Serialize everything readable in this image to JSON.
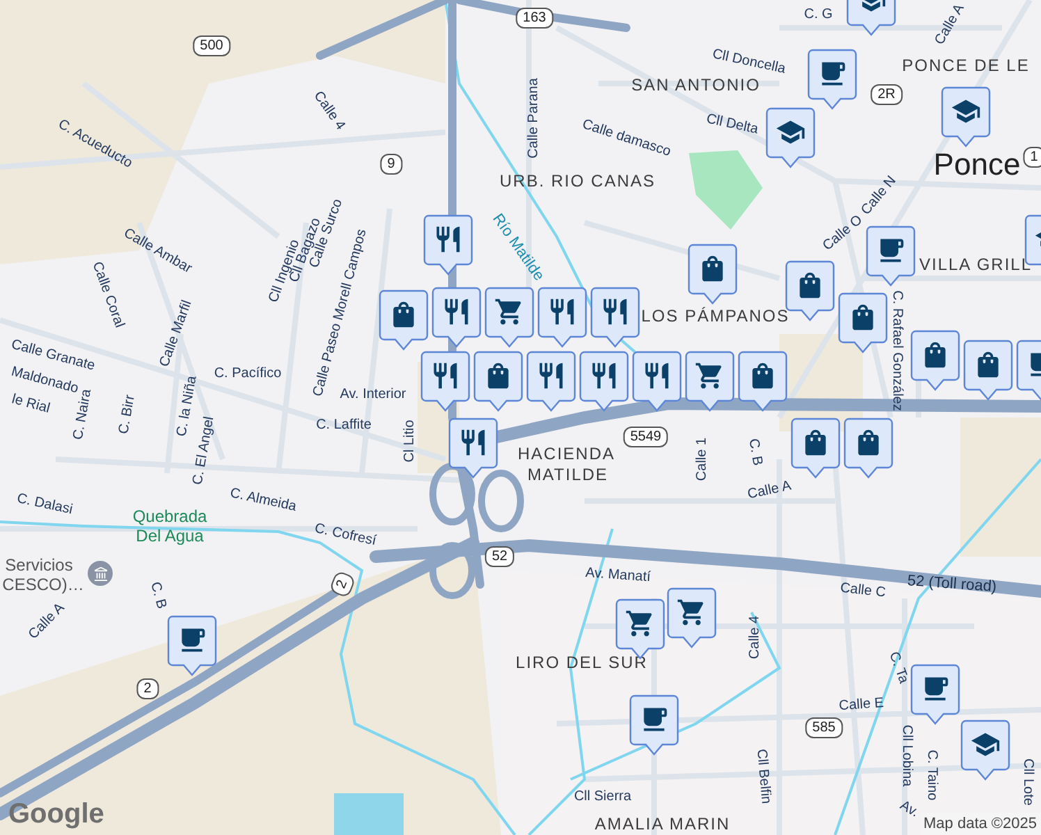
{
  "labels": [
    {
      "text": "500",
      "kind": "route"
    },
    {
      "text": "163",
      "kind": "route"
    },
    {
      "text": "2R",
      "kind": "route"
    },
    {
      "text": "9",
      "kind": "route"
    },
    {
      "text": "PONCE DE LE",
      "kind": "area"
    },
    {
      "text": "SAN ANTONIO",
      "kind": "area"
    },
    {
      "text": "URB. RIO CANAS",
      "kind": "area"
    },
    {
      "text": "Ponce",
      "kind": "city"
    },
    {
      "text": "1",
      "kind": "route"
    },
    {
      "text": "Calle 4",
      "kind": "street"
    },
    {
      "text": "C. Acueducto",
      "kind": "street"
    },
    {
      "text": "Calle Parana",
      "kind": "street"
    },
    {
      "text": "Calle damasco",
      "kind": "street"
    },
    {
      "text": "Cll Doncella",
      "kind": "street"
    },
    {
      "text": "Cll Delta",
      "kind": "street"
    },
    {
      "text": "Calle A",
      "kind": "street"
    },
    {
      "text": "C. G",
      "kind": "street"
    },
    {
      "text": "Calle Ambar",
      "kind": "street"
    },
    {
      "text": "Calle Coral",
      "kind": "street"
    },
    {
      "text": "Calle Marfil",
      "kind": "street"
    },
    {
      "text": "Cll Ingenio",
      "kind": "street"
    },
    {
      "text": "Cll Bagazo",
      "kind": "street"
    },
    {
      "text": "Calle Surco",
      "kind": "street"
    },
    {
      "text": "Calle Paseo Morell Campos",
      "kind": "street"
    },
    {
      "text": "Río Matilde",
      "kind": "water"
    },
    {
      "text": "Calle N",
      "kind": "street"
    },
    {
      "text": "Calle O",
      "kind": "street"
    },
    {
      "text": "C. Rafael González",
      "kind": "street"
    },
    {
      "text": "VILLA GRILL",
      "kind": "area"
    },
    {
      "text": "LOS PÁMPANOS",
      "kind": "area"
    },
    {
      "text": "Calle Granate",
      "kind": "street"
    },
    {
      "text": "Maldonado",
      "kind": "street"
    },
    {
      "text": "le Rial",
      "kind": "street"
    },
    {
      "text": "C. Pacífico",
      "kind": "street"
    },
    {
      "text": "Av. Interior",
      "kind": "street"
    },
    {
      "text": "C. Naira",
      "kind": "street"
    },
    {
      "text": "C. Birr",
      "kind": "street"
    },
    {
      "text": "C. la Niña",
      "kind": "street"
    },
    {
      "text": "C. El Angel",
      "kind": "street"
    },
    {
      "text": "C. Laffite",
      "kind": "street"
    },
    {
      "text": "Cl Litio",
      "kind": "street"
    },
    {
      "text": "HACIENDA",
      "kind": "area"
    },
    {
      "text": "MATILDE",
      "kind": "area"
    },
    {
      "text": "5549",
      "kind": "route"
    },
    {
      "text": "Calle 1",
      "kind": "street"
    },
    {
      "text": "C. B",
      "kind": "street"
    },
    {
      "text": "Calle A",
      "kind": "street"
    },
    {
      "text": "C. Dalasi",
      "kind": "street"
    },
    {
      "text": "C. Almeida",
      "kind": "street"
    },
    {
      "text": "Quebrada",
      "kind": "park"
    },
    {
      "text": "Del Agua",
      "kind": "park"
    },
    {
      "text": "C. Cofresí",
      "kind": "street"
    },
    {
      "text": "2",
      "kind": "route"
    },
    {
      "text": "52",
      "kind": "route"
    },
    {
      "text": "Servicios",
      "kind": "place"
    },
    {
      "text": "CESCO)…",
      "kind": "place"
    },
    {
      "text": "Calle A",
      "kind": "street"
    },
    {
      "text": "C. B",
      "kind": "street"
    },
    {
      "text": "2",
      "kind": "route"
    },
    {
      "text": "Av. Manatí",
      "kind": "street"
    },
    {
      "text": "52 (Toll road)",
      "kind": "highway"
    },
    {
      "text": "Calle C",
      "kind": "street"
    },
    {
      "text": "LIRO DEL SUR",
      "kind": "area"
    },
    {
      "text": "Calle 4",
      "kind": "street"
    },
    {
      "text": "C. Ta",
      "kind": "street"
    },
    {
      "text": "Calle E",
      "kind": "street"
    },
    {
      "text": "585",
      "kind": "route"
    },
    {
      "text": "Cll Belfin",
      "kind": "street"
    },
    {
      "text": "Cll Lobina",
      "kind": "street"
    },
    {
      "text": "C. Taino",
      "kind": "street"
    },
    {
      "text": "Cll Lote",
      "kind": "street"
    },
    {
      "text": "Cll Sierra",
      "kind": "street"
    },
    {
      "text": "Av.",
      "kind": "street"
    },
    {
      "text": "AMALIA MARIN",
      "kind": "area"
    }
  ],
  "pins": [
    {
      "kind": "cup"
    },
    {
      "kind": "cup"
    },
    {
      "kind": "cup"
    },
    {
      "kind": "cup"
    },
    {
      "kind": "cup"
    },
    {
      "kind": "cup"
    },
    {
      "kind": "school"
    },
    {
      "kind": "school"
    },
    {
      "kind": "school"
    },
    {
      "kind": "school"
    },
    {
      "kind": "school"
    },
    {
      "kind": "bag"
    },
    {
      "kind": "bag"
    },
    {
      "kind": "bag"
    },
    {
      "kind": "bag"
    },
    {
      "kind": "bag"
    },
    {
      "kind": "bag"
    },
    {
      "kind": "bag"
    },
    {
      "kind": "bag"
    },
    {
      "kind": "bag"
    },
    {
      "kind": "bag"
    },
    {
      "kind": "fork"
    },
    {
      "kind": "fork"
    },
    {
      "kind": "fork"
    },
    {
      "kind": "fork"
    },
    {
      "kind": "fork"
    },
    {
      "kind": "fork"
    },
    {
      "kind": "fork"
    },
    {
      "kind": "fork"
    },
    {
      "kind": "fork"
    },
    {
      "kind": "cart"
    },
    {
      "kind": "cart"
    },
    {
      "kind": "cart"
    },
    {
      "kind": "cart"
    }
  ],
  "logo": "Google",
  "attribution": "Map data ©2025"
}
